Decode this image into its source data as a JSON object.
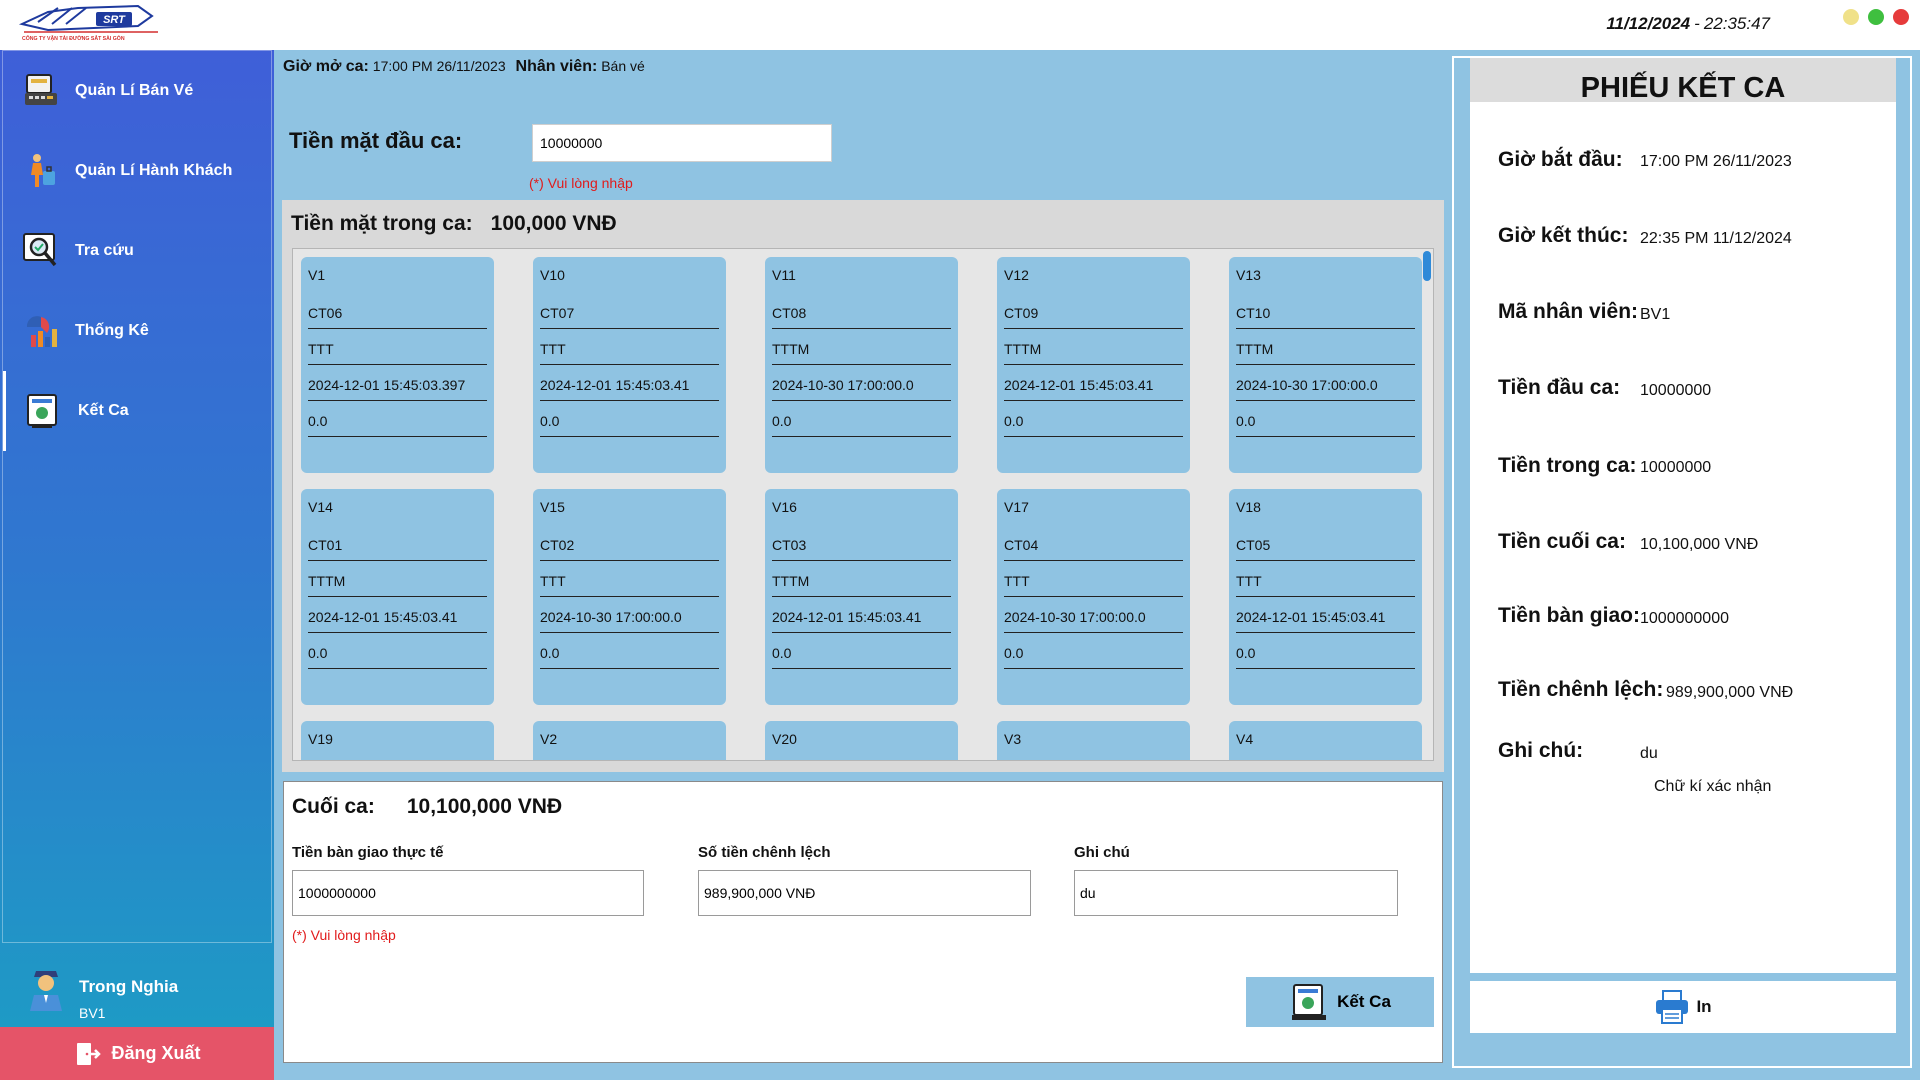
{
  "header": {
    "logo_text": "SRT",
    "logo_caption": "CÔNG TY VẬN TẢI ĐƯỜNG SẮT SÀI GÒN",
    "date": "11/12/2024",
    "separator": "-",
    "time": "22:35:47"
  },
  "sidebar": {
    "items": [
      {
        "label": "Quản Lí Bán Vé",
        "icon": "ticket-register-icon"
      },
      {
        "label": "Quản Lí Hành Khách",
        "icon": "passenger-icon"
      },
      {
        "label": "Tra cứu",
        "icon": "search-document-icon"
      },
      {
        "label": "Thống Kê",
        "icon": "statistics-chart-icon"
      },
      {
        "label": "Kết Ca",
        "icon": "end-shift-icon"
      }
    ],
    "user": {
      "name": "Trong Nghia",
      "id": "BV1"
    },
    "logout_label": "Đăng Xuất"
  },
  "main": {
    "open_time_label": "Giờ mở ca:",
    "open_time_value": "17:00 PM 26/11/2023",
    "staff_label": "Nhân viên:",
    "staff_value": "Bán vé",
    "cash_start_label": "Tiền mặt đầu ca:",
    "cash_start_value": "10000000",
    "cash_start_hint": "(*) Vui  lòng nhập",
    "in_shift_label": "Tiền mặt trong ca:",
    "in_shift_value": "100,000 VNĐ",
    "tickets": [
      {
        "id": "V1",
        "route": "CT06",
        "type": "TTT",
        "date": "2024-12-01 15:45:03.397",
        "amount": "0.0"
      },
      {
        "id": "V10",
        "route": "CT07",
        "type": "TTT",
        "date": "2024-12-01 15:45:03.41",
        "amount": "0.0"
      },
      {
        "id": "V11",
        "route": "CT08",
        "type": "TTTM",
        "date": "2024-10-30 17:00:00.0",
        "amount": "0.0"
      },
      {
        "id": "V12",
        "route": "CT09",
        "type": "TTTM",
        "date": "2024-12-01 15:45:03.41",
        "amount": "0.0"
      },
      {
        "id": "V13",
        "route": "CT10",
        "type": "TTTM",
        "date": "2024-10-30 17:00:00.0",
        "amount": "0.0"
      },
      {
        "id": "V14",
        "route": "CT01",
        "type": "TTTM",
        "date": "2024-12-01 15:45:03.41",
        "amount": "0.0"
      },
      {
        "id": "V15",
        "route": "CT02",
        "type": "TTT",
        "date": "2024-10-30 17:00:00.0",
        "amount": "0.0"
      },
      {
        "id": "V16",
        "route": "CT03",
        "type": "TTTM",
        "date": "2024-12-01 15:45:03.41",
        "amount": "0.0"
      },
      {
        "id": "V17",
        "route": "CT04",
        "type": "TTT",
        "date": "2024-10-30 17:00:00.0",
        "amount": "0.0"
      },
      {
        "id": "V18",
        "route": "CT05",
        "type": "TTT",
        "date": "2024-12-01 15:45:03.41",
        "amount": "0.0"
      },
      {
        "id": "V19",
        "route": "",
        "type": "",
        "date": "",
        "amount": ""
      },
      {
        "id": "V2",
        "route": "",
        "type": "",
        "date": "",
        "amount": ""
      },
      {
        "id": "V20",
        "route": "",
        "type": "",
        "date": "",
        "amount": ""
      },
      {
        "id": "V3",
        "route": "",
        "type": "",
        "date": "",
        "amount": ""
      },
      {
        "id": "V4",
        "route": "",
        "type": "",
        "date": "",
        "amount": ""
      }
    ],
    "end": {
      "title_label": "Cuối ca:",
      "title_value": "10,100,000 VNĐ",
      "handover_label": "Tiền bàn giao thực tế",
      "handover_value": "1000000000",
      "diff_label": "Số tiền chênh lệch",
      "diff_value": "989,900,000 VNĐ",
      "note_label": "Ghi chú",
      "note_value": "du",
      "hint": "(*) Vui lòng nhập",
      "button_label": "Kết Ca"
    }
  },
  "receipt": {
    "title": "PHIẾU KẾT CA",
    "rows": [
      {
        "label": "Giờ bắt đầu:",
        "value": "17:00 PM 26/11/2023"
      },
      {
        "label": "Giờ kết thúc:",
        "value": "22:35 PM 11/12/2024"
      },
      {
        "label": "Mã nhân viên:",
        "value": "BV1"
      },
      {
        "label": "Tiền đầu ca:",
        "value": "10000000"
      },
      {
        "label": "Tiền trong ca:",
        "value": "10000000"
      },
      {
        "label": "Tiền cuối ca:",
        "value": "10,100,000 VNĐ"
      },
      {
        "label": "Tiền bàn giao:",
        "value": "1000000000"
      },
      {
        "label": "Tiền chênh lệch:",
        "value": "989,900,000 VNĐ"
      },
      {
        "label": "Ghi chú:",
        "value": "du"
      }
    ],
    "signature": "Chữ kí xác nhận",
    "print_label": "In"
  },
  "colors": {
    "panel_blue": "#8fc3e2",
    "sidebar_top": "#3f5fd8",
    "sidebar_bottom": "#1c9ec4",
    "logout_red": "#e55468",
    "hint_red": "#e11b1b"
  }
}
